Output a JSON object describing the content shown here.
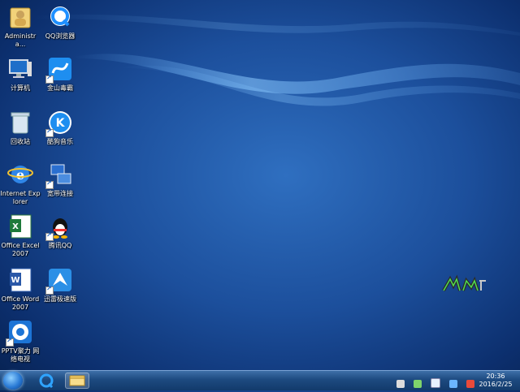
{
  "desktop": {
    "icons": [
      {
        "label": "Administra...",
        "icon": "user-folder-icon"
      },
      {
        "label": "QQ浏览器",
        "icon": "qq-browser-icon"
      },
      {
        "label": "计算机",
        "icon": "computer-icon"
      },
      {
        "label": "金山毒霸",
        "icon": "kingsoft-antivirus-icon"
      },
      {
        "label": "回收站",
        "icon": "recycle-bin-icon"
      },
      {
        "label": "酷狗音乐",
        "icon": "kugou-music-icon"
      },
      {
        "label": "Internet Explorer",
        "icon": "internet-explorer-icon"
      },
      {
        "label": "宽带连接",
        "icon": "broadband-connection-icon"
      },
      {
        "label": "Office Excel 2007",
        "icon": "excel-icon"
      },
      {
        "label": "腾讯QQ",
        "icon": "qq-penguin-icon"
      },
      {
        "label": "Office Word 2007",
        "icon": "word-icon"
      },
      {
        "label": "迅雷极速版",
        "icon": "xunlei-icon"
      },
      {
        "label": "PPTV聚力 网络电视",
        "icon": "pptv-icon"
      }
    ]
  },
  "taskbar": {
    "start_icon": "windows-start-icon",
    "pinned": [
      {
        "icon": "qq-browser-icon"
      },
      {
        "icon": "file-explorer-icon"
      }
    ],
    "tray_icons": [
      "notification-icon",
      "network-icon",
      "antivirus-tray-icon",
      "security-tray-icon",
      "volume-icon"
    ],
    "clock": {
      "time": "20:36",
      "date": "2016/2/25"
    }
  },
  "colors": {
    "accent": "#1c4f9c",
    "taskbar": "#1d4a80"
  }
}
